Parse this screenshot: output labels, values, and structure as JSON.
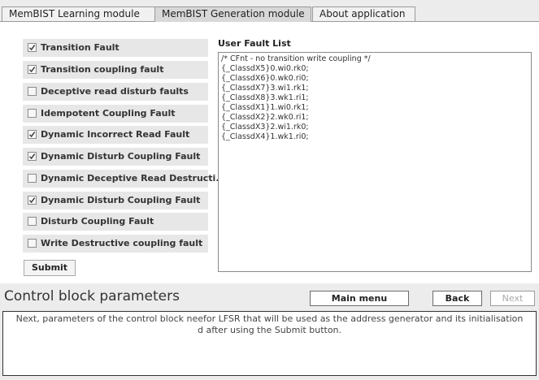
{
  "tabs": [
    {
      "label": "MemBIST Learning module"
    },
    {
      "label": "MemBIST Generation module"
    },
    {
      "label": "About application"
    }
  ],
  "faults": [
    {
      "label": "Transition Fault",
      "checked": true
    },
    {
      "label": "Transition coupling fault",
      "checked": true
    },
    {
      "label": "Deceptive read disturb faults",
      "checked": false
    },
    {
      "label": "Idempotent Coupling Fault",
      "checked": false
    },
    {
      "label": "Dynamic Incorrect Read Fault",
      "checked": true
    },
    {
      "label": "Dynamic Disturb Coupling Fault",
      "checked": true
    },
    {
      "label": "Dynamic Deceptive Read Destructi...",
      "checked": false
    },
    {
      "label": "Dynamic Disturb Coupling Fault",
      "checked": true
    },
    {
      "label": "Disturb Coupling Fault",
      "checked": false
    },
    {
      "label": "Write Destructive coupling fault",
      "checked": false
    }
  ],
  "submit_label": "Submit",
  "fault_list": {
    "title": "User Fault List",
    "lines": [
      "/* CFnt - no transition write coupling */",
      "{_ClassdX5}0.wi0.rk0;",
      "{_ClassdX6}0.wk0.ri0;",
      "{_ClassdX7}3.wi1.rk1;",
      "{_ClassdX8}3.wk1.ri1;",
      "{_ClassdX1}1.wi0.rk1;",
      "{_ClassdX2}2.wk0.ri1;",
      "{_ClassdX3}2.wi1.rk0;",
      "{_ClassdX4}1.wk1.ri0;"
    ]
  },
  "control": {
    "title": "Control block parameters",
    "main_menu": "Main menu",
    "back": "Back",
    "next": "Next",
    "description_line1": "Next, parameters of the control block neefor LFSR that will be used as the address generator and its initialisation",
    "description_line2": "d after using the Submit button."
  }
}
